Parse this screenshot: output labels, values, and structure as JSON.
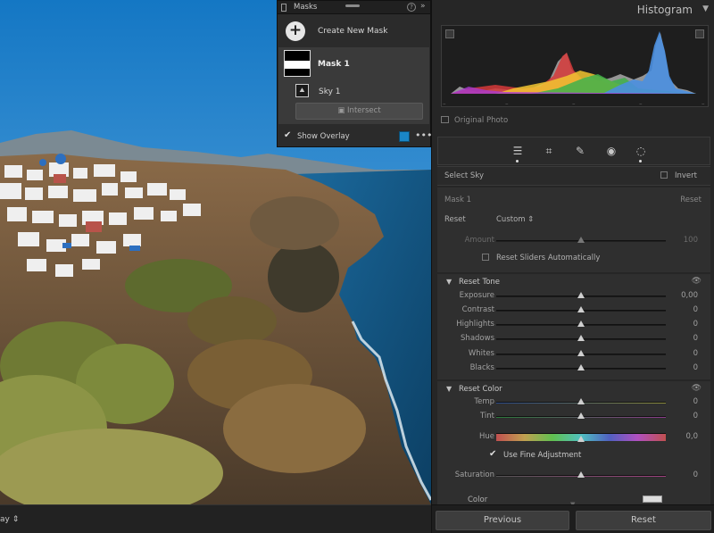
{
  "masks_panel": {
    "title": "Masks",
    "create_label": "Create New Mask",
    "mask1_label": "Mask 1",
    "sky_label": "Sky 1",
    "intersect_label": "Intersect",
    "show_overlay_label": "Show Overlay",
    "show_overlay_checked": true,
    "overlay_color": "#1a86c6"
  },
  "toolbar": {
    "overlay_mode_label": "ay ⇕"
  },
  "histogram": {
    "title": "Histogram",
    "original_photo_label": "Original Photo",
    "tick_marks": [
      "–",
      "–",
      "–",
      "–",
      "–"
    ]
  },
  "tools": [
    "sliders-icon",
    "crop-icon",
    "heal-icon",
    "redeye-icon",
    "mask-icon"
  ],
  "select_sky": {
    "label": "Select Sky",
    "invert_label": "Invert"
  },
  "mask_section": {
    "mask_name": "Mask 1",
    "reset_label": "Reset",
    "reset_row_label": "Reset",
    "preset_value": "Custom ⇕",
    "amount_label": "Amount",
    "amount_value": "100",
    "reset_auto_label": "Reset Sliders Automatically"
  },
  "tone": {
    "title": "Reset Tone",
    "sliders": [
      {
        "name": "Exposure",
        "value": "0,00"
      },
      {
        "name": "Contrast",
        "value": "0"
      },
      {
        "name": "Highlights",
        "value": "0"
      },
      {
        "name": "Shadows",
        "value": "0"
      },
      {
        "name": "Whites",
        "value": "0"
      },
      {
        "name": "Blacks",
        "value": "0"
      }
    ]
  },
  "color": {
    "title": "Reset Color",
    "temp": {
      "name": "Temp",
      "value": "0"
    },
    "tint": {
      "name": "Tint",
      "value": "0"
    },
    "hue": {
      "name": "Hue",
      "value": "0,0"
    },
    "fine_label": "Use Fine Adjustment",
    "saturation": {
      "name": "Saturation",
      "value": "0"
    },
    "color_label": "Color"
  },
  "bottom": {
    "previous_label": "Previous",
    "reset_label": "Reset"
  }
}
